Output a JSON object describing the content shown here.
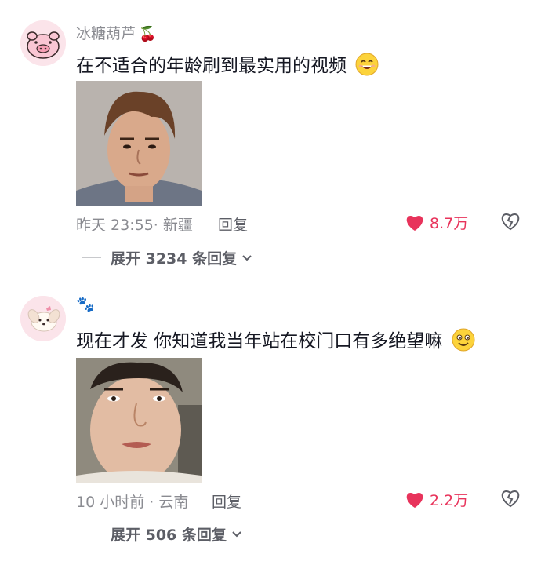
{
  "comments": [
    {
      "username": "冰糖葫芦",
      "username_emoji": "🍒",
      "text": "在不适合的年龄刷到最实用的视频",
      "time": "昨天 23:55",
      "location": "新疆",
      "reply_label": "回复",
      "likes": "8.7万",
      "expand_label": "展开 3234 条回复",
      "avatar_icon": "pig-avatar-icon",
      "photo_icon": "man-portrait-photo"
    },
    {
      "username": "🐾",
      "text": "现在才发 你知道我当年站在校门口有多绝望嘛",
      "time": "10 小时前",
      "location": "云南",
      "reply_label": "回复",
      "likes": "2.2万",
      "expand_label": "展开 506 条回复",
      "avatar_icon": "puppy-avatar-icon",
      "photo_icon": "young-man-portrait-photo"
    }
  ],
  "colors": {
    "like": "#e8335b",
    "muted": "#8a8b91",
    "text": "#161823"
  }
}
